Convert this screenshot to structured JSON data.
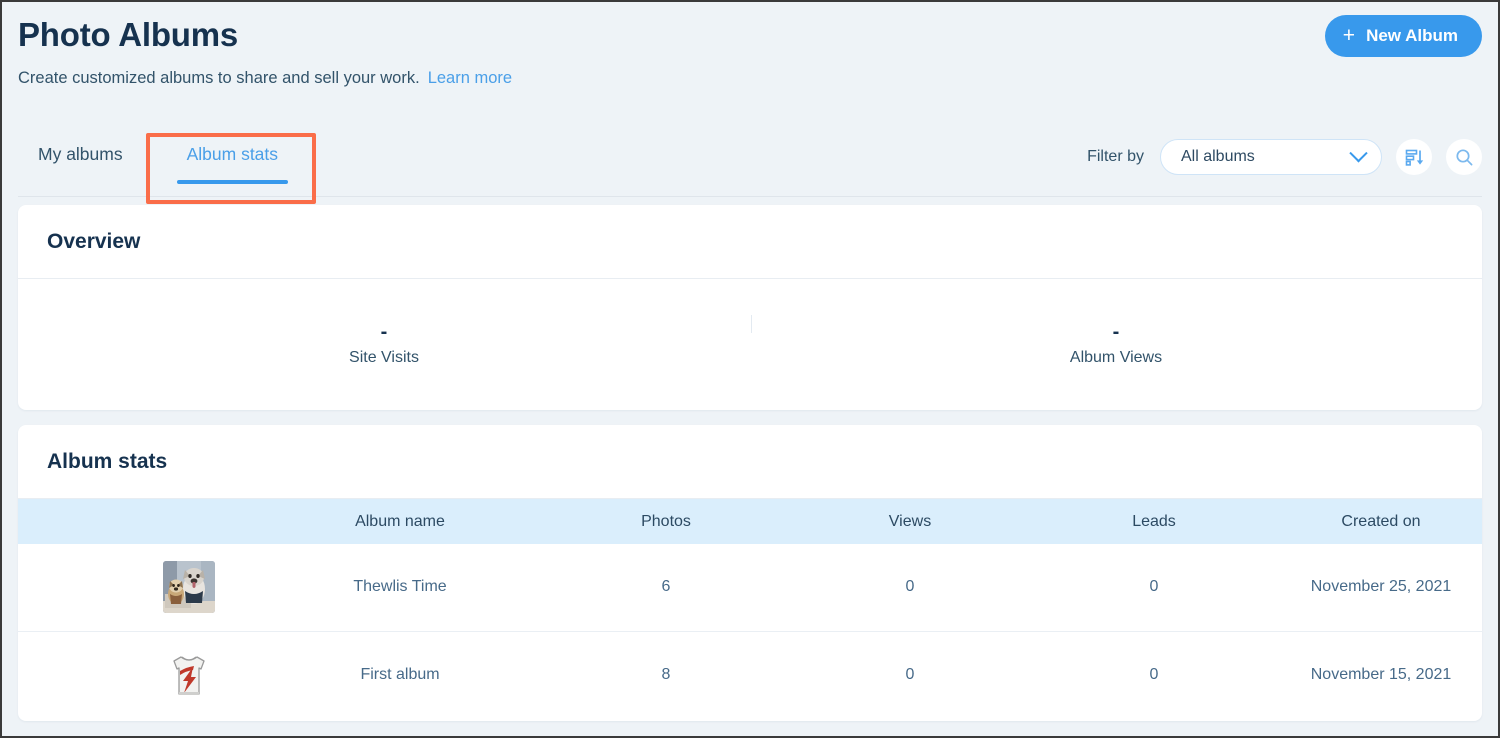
{
  "header": {
    "title": "Photo Albums",
    "subtitle": "Create customized albums to share and sell your work.",
    "learn_more": "Learn more",
    "new_album_button": "New Album",
    "plus_icon": "plus-icon"
  },
  "tabs": [
    {
      "label": "My albums",
      "active": false
    },
    {
      "label": "Album stats",
      "active": true
    }
  ],
  "filter": {
    "label": "Filter by",
    "dropdown_value": "All albums",
    "dropdown_options": [
      "All albums"
    ],
    "sort_icon": "sort-descending-icon",
    "search_icon": "search-icon",
    "chevron_icon": "chevron-down-icon"
  },
  "overview": {
    "title": "Overview",
    "stats": [
      {
        "value": "-",
        "label": "Site Visits"
      },
      {
        "value": "-",
        "label": "Album Views"
      }
    ]
  },
  "album_stats": {
    "title": "Album stats",
    "columns": [
      "",
      "Album name",
      "Photos",
      "Views",
      "Leads",
      "Created on"
    ],
    "rows": [
      {
        "thumbnail": "two-dogs-photo-thumbnail",
        "name": "Thewlis Time",
        "photos": "6",
        "views": "0",
        "leads": "0",
        "created_on": "November 25, 2021"
      },
      {
        "thumbnail": "tank-top-lightning-bolt-thumbnail",
        "name": "First album",
        "photos": "8",
        "views": "0",
        "leads": "0",
        "created_on": "November 15, 2021"
      }
    ]
  },
  "colors": {
    "accent": "#3899ec",
    "link": "#4a9fe8",
    "page_bg": "#eef3f7",
    "card_bg": "#ffffff",
    "table_header_bg": "#daeefc",
    "title": "#16324f",
    "annotation": "#fa6d49"
  }
}
